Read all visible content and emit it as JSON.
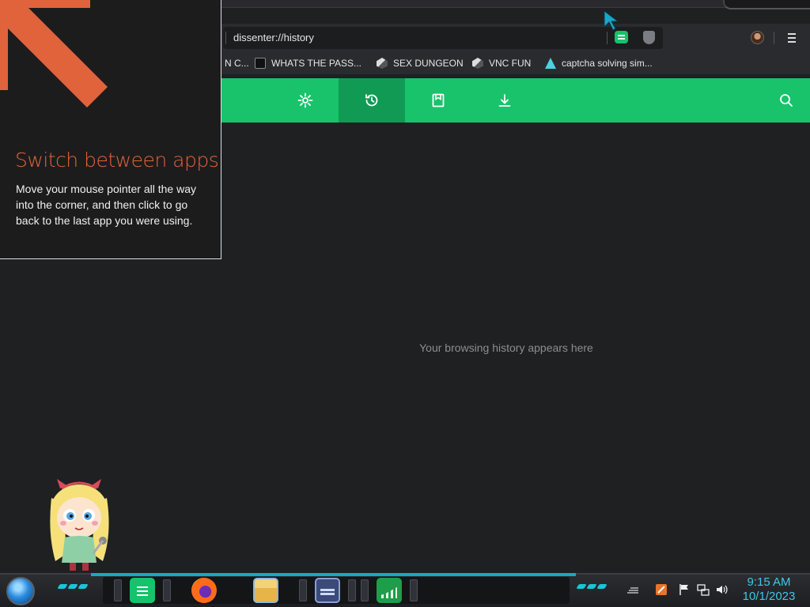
{
  "browser": {
    "url": "dissenter://history",
    "bookmarks": [
      {
        "label": "N C...",
        "icon": "bookmark-favicon"
      },
      {
        "label": "WHATS THE PASS...",
        "icon": "dark-square-favicon"
      },
      {
        "label": "SEX DUNGEON",
        "icon": "cube-favicon"
      },
      {
        "label": "VNC FUN",
        "icon": "cube-favicon"
      },
      {
        "label": "captcha solving sim...",
        "icon": "triangle-favicon"
      }
    ],
    "nav_tabs": [
      {
        "name": "settings",
        "icon": "gear-icon",
        "active": false
      },
      {
        "name": "history",
        "icon": "history-icon",
        "active": true
      },
      {
        "name": "bookmarks",
        "icon": "bookmark-icon",
        "active": false
      },
      {
        "name": "downloads",
        "icon": "download-icon",
        "active": false
      }
    ],
    "empty_message": "Your browsing history appears here",
    "colors": {
      "accent": "#18c36c",
      "accent_active": "#119a54",
      "background": "#1f2022"
    }
  },
  "tip": {
    "title": "Switch between apps",
    "body": "Move your mouse pointer all the way into the corner, and then click to go back to the last app you were using.",
    "accent": "#e1633c"
  },
  "taskbar": {
    "apps": [
      "chat-app",
      "firefox",
      "file-explorer",
      "card-app",
      "stocks-app"
    ],
    "clock": {
      "time": "9:15 AM",
      "date": "10/1/2023"
    }
  }
}
